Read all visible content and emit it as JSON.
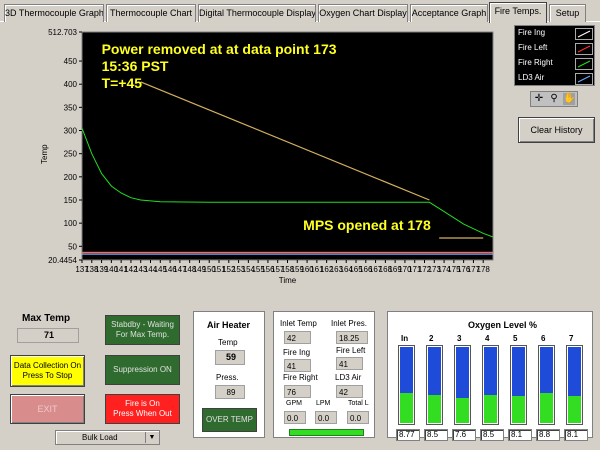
{
  "tabs": [
    {
      "label": "3D Thermocouple Graph",
      "active": false
    },
    {
      "label": "Thermocouple Chart",
      "active": false
    },
    {
      "label": "Digital Thermocouple Display",
      "active": false
    },
    {
      "label": "Oxygen Chart Display",
      "active": false
    },
    {
      "label": "Acceptance Graph",
      "active": false
    },
    {
      "label": "Fire Temps.",
      "active": true
    },
    {
      "label": "Setup",
      "active": false
    }
  ],
  "chart_data": {
    "type": "line",
    "xlabel": "Time",
    "ylabel": "Temp",
    "xlim": [
      137,
      179
    ],
    "ylim": [
      20.4454,
      512.703
    ],
    "xticks": [
      "137",
      "138",
      "139",
      "140",
      "141",
      "142",
      "143",
      "144",
      "145",
      "146",
      "147",
      "148",
      "149",
      "150",
      "151",
      "152",
      "153",
      "154",
      "155",
      "156",
      "157",
      "158",
      "159",
      "160",
      "161",
      "162",
      "163",
      "164",
      "165",
      "166",
      "167",
      "168",
      "169",
      "170",
      "171",
      "172",
      "173",
      "174",
      "175",
      "176",
      "177",
      "178"
    ],
    "yticks": [
      "512.703",
      "450",
      "400",
      "350",
      "300",
      "250",
      "200",
      "150",
      "100",
      "50",
      "20.4454"
    ],
    "series": [
      {
        "name": "Fire Ing",
        "color": "#ffffff",
        "x": [
          137,
          150,
          160,
          170,
          179
        ],
        "y": [
          36,
          36,
          36,
          36,
          36
        ]
      },
      {
        "name": "Fire Left",
        "color": "#ff3030",
        "x": [
          137,
          179
        ],
        "y": [
          37,
          37
        ]
      },
      {
        "name": "Fire Right",
        "color": "#22dd22",
        "x": [
          137,
          138,
          139,
          140,
          141,
          142,
          143,
          145,
          150,
          160,
          170,
          172.5,
          174,
          176,
          178,
          179
        ],
        "y": [
          305,
          250,
          207,
          180,
          165,
          155,
          150,
          146,
          145,
          145,
          145,
          145,
          125,
          98,
          78,
          70
        ]
      },
      {
        "name": "LD3 Air",
        "color": "#66aaff",
        "x": [
          137,
          179
        ],
        "y": [
          33,
          33
        ]
      }
    ],
    "annotations": [
      {
        "text": "Power removed at at data point 173",
        "color": "#ffff22"
      },
      {
        "text": "15:36 PST",
        "color": "#ffff22"
      },
      {
        "text": "T=+45",
        "color": "#ffff22"
      },
      {
        "text": "MPS opened at 178",
        "color": "#ffff22"
      }
    ],
    "annotation_line": {
      "x": [
        143,
        172.5
      ],
      "y": [
        405,
        150
      ],
      "color": "#d4b060"
    },
    "annotation_underline": {
      "x": [
        173.5,
        178
      ],
      "y": [
        68,
        68
      ],
      "color": "#d4b060"
    },
    "legend_position": "right"
  },
  "legend": [
    {
      "name": "Fire Ing",
      "color": "#ffffff"
    },
    {
      "name": "Fire Left",
      "color": "#ff3030"
    },
    {
      "name": "Fire Right",
      "color": "#22dd22"
    },
    {
      "name": "LD3 Air",
      "color": "#66aaff"
    }
  ],
  "clear_history_label": "Clear History",
  "max_temp": {
    "label": "Max Temp",
    "value": "71"
  },
  "buttons": {
    "data_collection": "Data Collection On\nPress To Stop",
    "exit": "EXIT",
    "standby": "Stabdby - Waiting\nFor Max Temp.",
    "suppression": "Suppression ON",
    "fire_on": "Fire is On\nPress When Out",
    "bulk_load": "Bulk Load",
    "over_temp": "OVER TEMP"
  },
  "air_heater": {
    "title": "Air Heater",
    "temp_label": "Temp",
    "temp_value": "59",
    "press_label": "Press.",
    "press_value": "89"
  },
  "inlet": {
    "inlet_temp_label": "Inlet Temp",
    "inlet_temp": "42",
    "inlet_pres_label": "Inlet Pres.",
    "inlet_pres": "18.25",
    "fire_ing_label": "Fire Ing",
    "fire_ing": "41",
    "fire_left_label": "Fire Left",
    "fire_left": "41",
    "fire_right_label": "Fire Right",
    "fire_right": "76",
    "ld3_air_label": "LD3 Air",
    "ld3_air": "42",
    "gpm_label": "GPM",
    "gpm": "0.0",
    "lpm_label": "LPM",
    "lpm": "0.0",
    "total_label": "Total L",
    "total": "0.0"
  },
  "oxygen": {
    "title": "Oxygen Level %",
    "channels": [
      {
        "label": "In",
        "value": "8.77",
        "level": 0.38
      },
      {
        "label": "2",
        "value": "8.5",
        "level": 0.36
      },
      {
        "label": "3",
        "value": "7.6",
        "level": 0.32
      },
      {
        "label": "4",
        "value": "8.5",
        "level": 0.36
      },
      {
        "label": "5",
        "value": "8.1",
        "level": 0.34
      },
      {
        "label": "6",
        "value": "8.8",
        "level": 0.38
      },
      {
        "label": "7",
        "value": "8.1",
        "level": 0.34
      }
    ]
  }
}
